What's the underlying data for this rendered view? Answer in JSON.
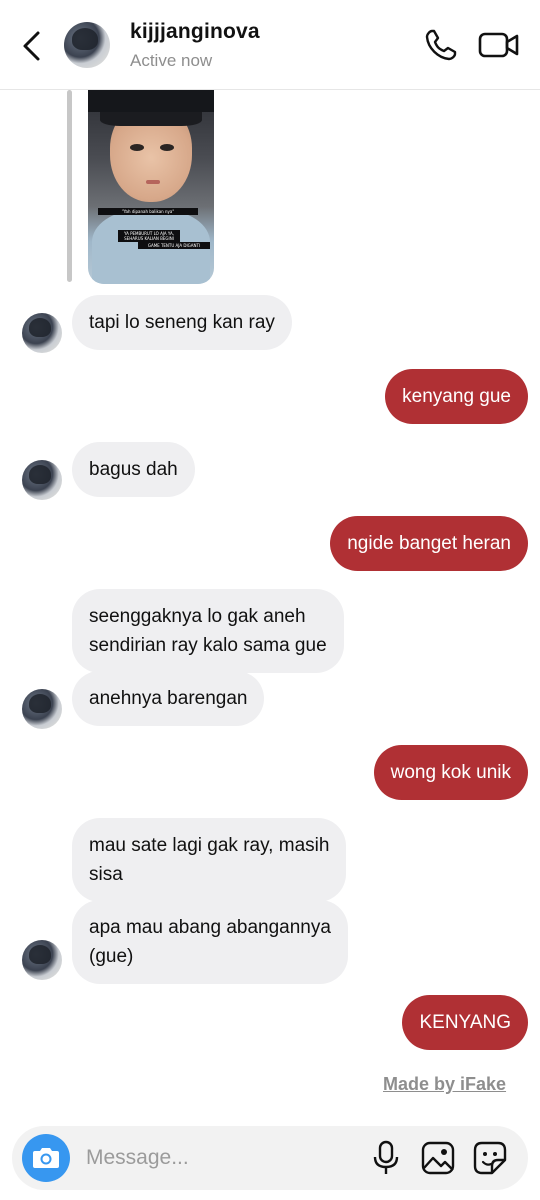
{
  "header": {
    "username": "kijjjanginova",
    "status": "Active now",
    "icons": {
      "back": "chevron-left-icon",
      "call": "phone-icon",
      "video": "video-camera-icon"
    }
  },
  "shared_photo": {
    "caption_lines": [
      "\"Yah dipanah balikan nya\"",
      "YA PEMBURUT LO AJA YA, SEHARUS KALIAN BEGINI",
      "GAME TENTU AJA DIGANTI"
    ]
  },
  "messages": [
    {
      "side": "in",
      "text": "tapi lo seneng kan ray"
    },
    {
      "side": "out",
      "text": "kenyang gue"
    },
    {
      "side": "in",
      "text": "bagus dah"
    },
    {
      "side": "out",
      "text": "ngide banget heran"
    },
    {
      "side": "in",
      "text": "seenggaknya lo gak aneh\nsendirian ray kalo sama gue"
    },
    {
      "side": "in",
      "text": "anehnya barengan"
    },
    {
      "side": "out",
      "text": "wong kok unik"
    },
    {
      "side": "in",
      "text": "mau sate lagi gak ray, masih\nsisa"
    },
    {
      "side": "in",
      "text": "apa mau abang abangannya\n(gue)"
    },
    {
      "side": "out",
      "text": "KENYANG"
    }
  ],
  "watermark": "Made by iFake",
  "composer": {
    "placeholder": "Message...",
    "icons": {
      "camera": "camera-icon",
      "mic": "microphone-icon",
      "image": "image-icon",
      "sticker": "sticker-icon"
    }
  },
  "colors": {
    "outgoing_bubble": "#b03034",
    "incoming_bubble": "#efeff1",
    "camera_button": "#3797f0"
  }
}
